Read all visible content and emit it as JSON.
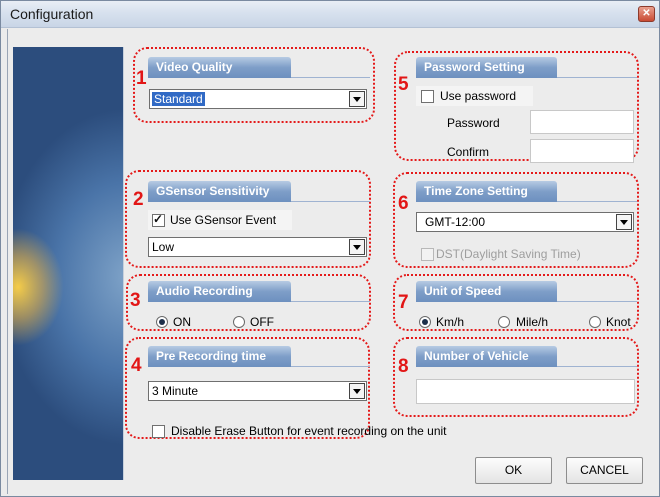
{
  "window": {
    "title": "Configuration",
    "close_icon": "close-icon"
  },
  "side_image": {
    "description_icon": "car-headlight-image"
  },
  "badges": [
    "1",
    "2",
    "3",
    "4",
    "5",
    "6",
    "7",
    "8"
  ],
  "video_quality": {
    "header": "Video Quality",
    "selected": "Standard"
  },
  "gsensor": {
    "header": "GSensor Sensitivity",
    "checkbox_label": "Use GSensor Event",
    "checked": true,
    "selected": "Low"
  },
  "audio": {
    "header": "Audio Recording",
    "options": [
      "ON",
      "OFF"
    ],
    "selected": "ON"
  },
  "pre_recording": {
    "header": "Pre Recording time",
    "selected": "3 Minute",
    "erase_label": "Disable Erase Button for event recording on the unit",
    "erase_checked": false
  },
  "password": {
    "header": "Password Setting",
    "checkbox_label": "Use password",
    "checked": false,
    "password_label": "Password",
    "confirm_label": "Confirm"
  },
  "timezone": {
    "header": "Time Zone Setting",
    "selected": "GMT-12:00",
    "dst_label": "DST(Daylight Saving Time)",
    "dst_checked": false
  },
  "speed": {
    "header": "Unit of Speed",
    "options": [
      "Km/h",
      "Mile/h",
      "Knot"
    ],
    "selected": "Km/h"
  },
  "vehicle": {
    "header": "Number of Vehicle",
    "value": ""
  },
  "buttons": {
    "ok": "OK",
    "cancel": "CANCEL"
  },
  "colors": {
    "annotation_red": "#e41a1a",
    "header_blue": "#6d90bf",
    "selection_blue": "#316ac5"
  }
}
